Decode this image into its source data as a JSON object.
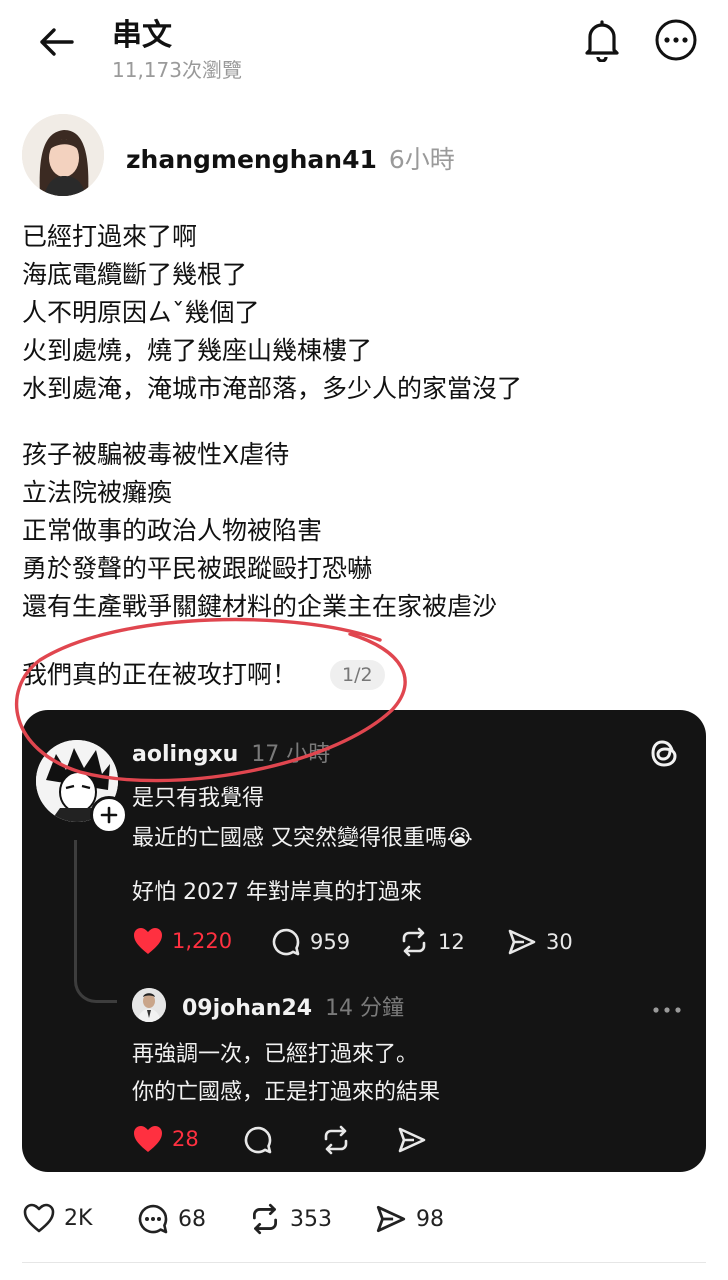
{
  "header": {
    "title": "串文",
    "views": "11,173次瀏覽"
  },
  "post": {
    "username": "zhangmenghan41",
    "time": "6小時",
    "paragraph1": [
      "已經打過來了啊",
      "海底電纜斷了幾根了",
      "人不明原因ㄙˇ幾個了",
      "火到處燒，燒了幾座山幾棟樓了",
      "水到處淹，淹城市淹部落，多少人的家當沒了"
    ],
    "paragraph2": [
      "孩子被騙被毒被性X虐待",
      "立法院被癱瘓",
      "正常做事的政治人物被陷害",
      "勇於發聲的平民被跟蹤毆打恐嚇",
      "還有生產戰爭關鍵材料的企業主在家被虐沙"
    ],
    "closing": "我們真的正在被攻打啊！",
    "page_badge": "1/2"
  },
  "quoted": {
    "username": "aolingxu",
    "time": "17 小時",
    "lines": [
      "是只有我覺得",
      "最近的亡國感 又突然變得很重嗎😭"
    ],
    "line3": "好怕 2027 年對岸真的打過來",
    "likes": "1,220",
    "comments": "959",
    "reposts": "12",
    "shares": "30",
    "reply": {
      "username": "09johan24",
      "time": "14 分鐘",
      "lines": [
        "再強調一次，已經打過來了。",
        "你的亡國感，正是打過來的結果"
      ],
      "likes": "28"
    }
  },
  "footer": {
    "likes": "2K",
    "comments": "68",
    "reposts": "353",
    "shares": "98"
  },
  "colors": {
    "heart_red": "#ff3040",
    "annotation_red": "#e0464f",
    "card_bg": "#141414"
  }
}
